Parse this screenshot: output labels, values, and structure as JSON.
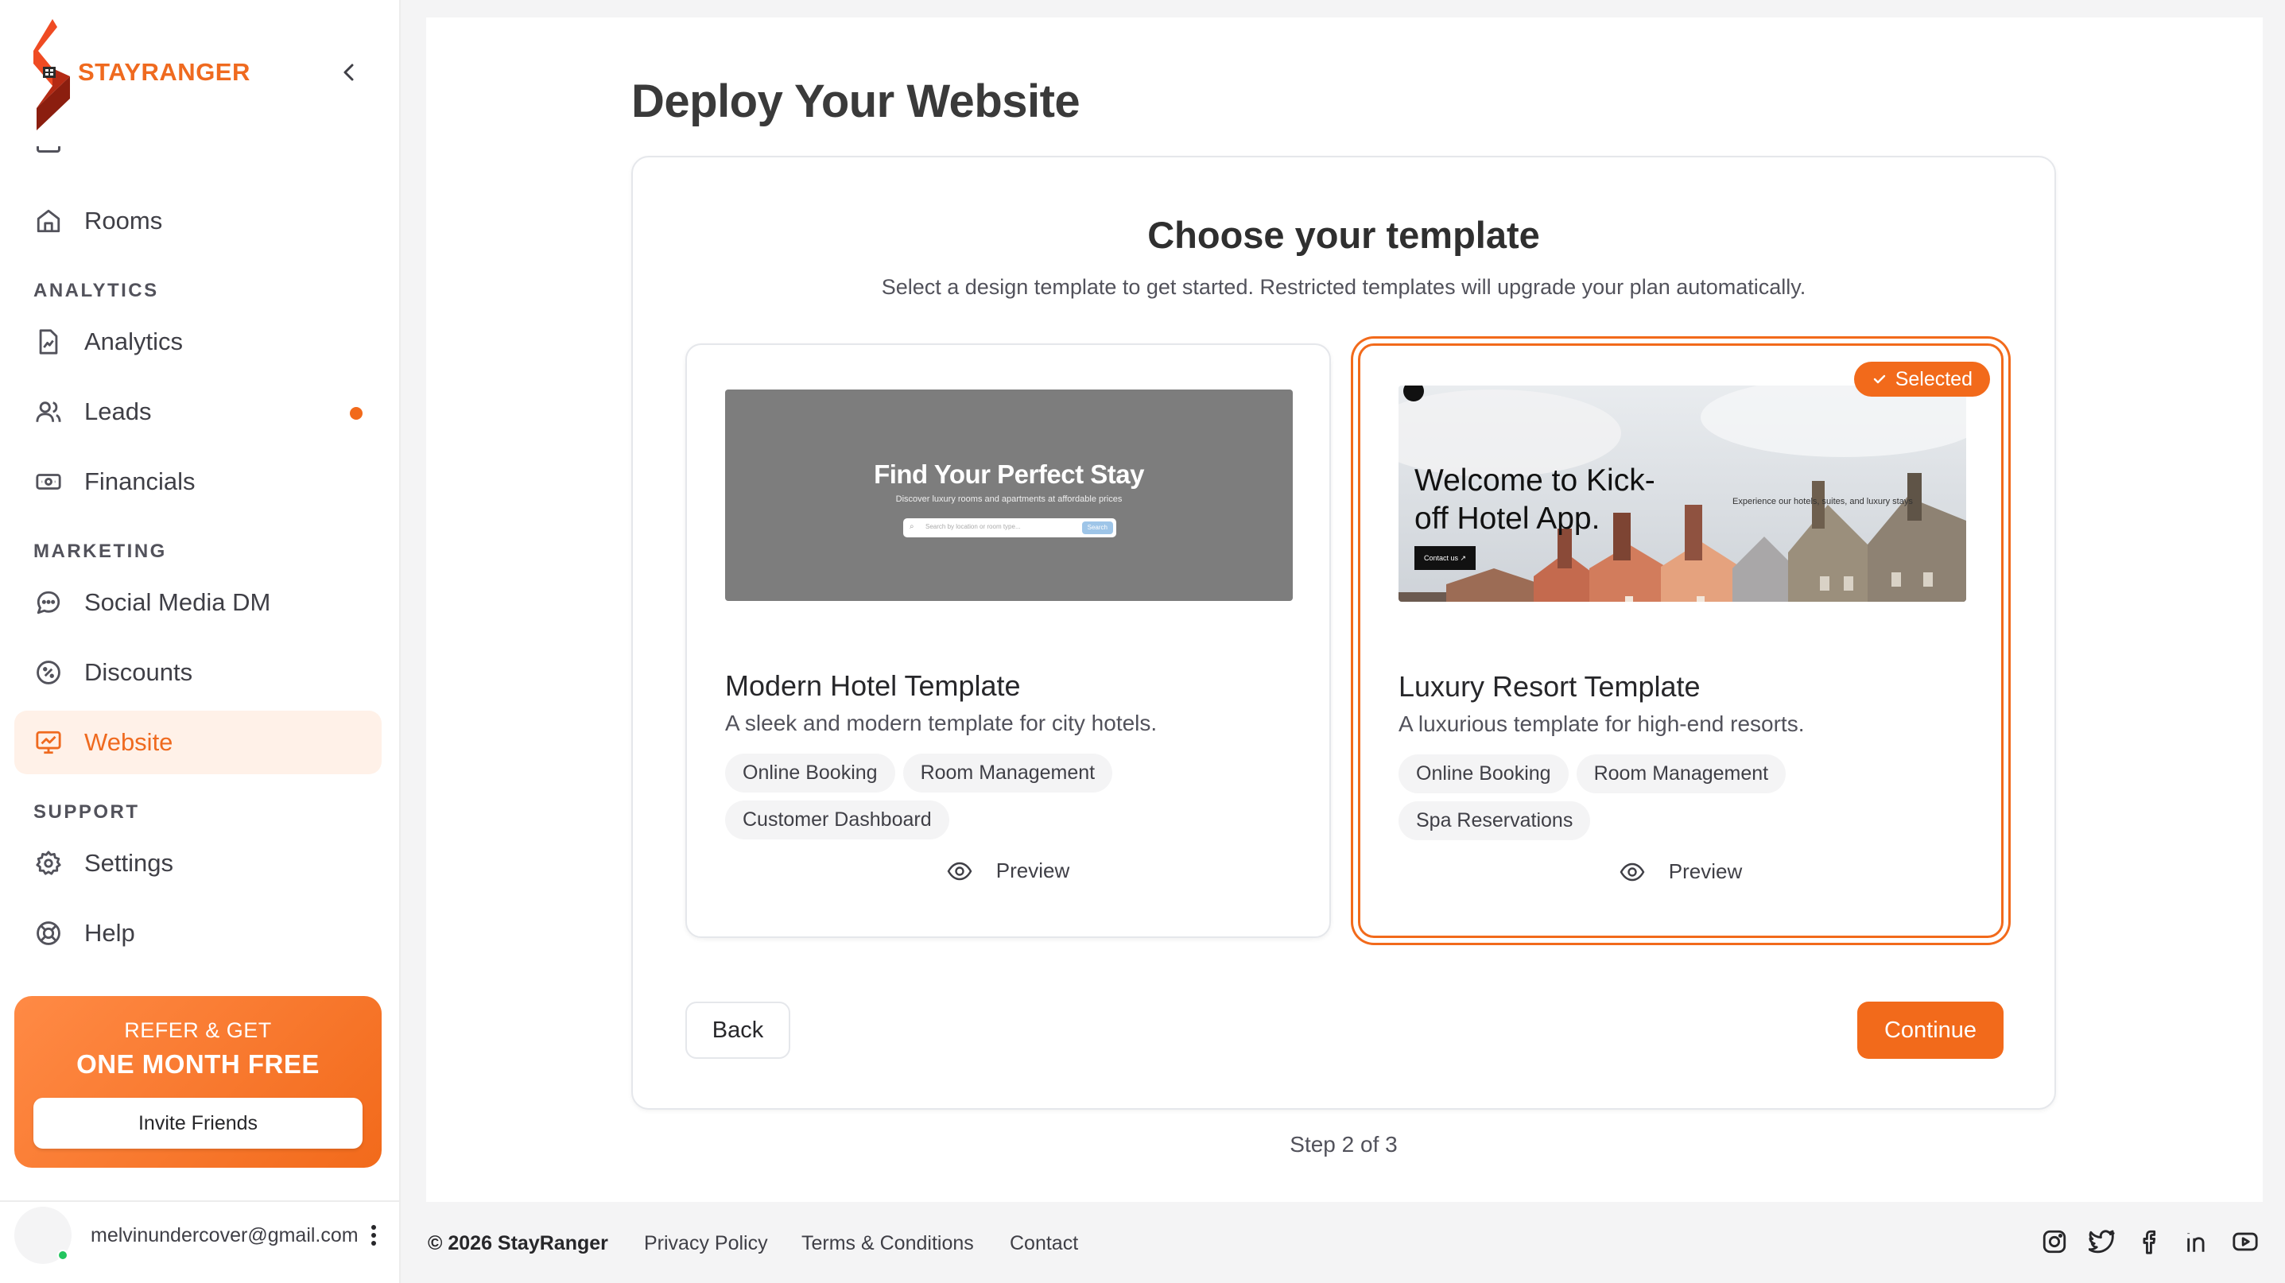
{
  "brand": {
    "name": "STAYRANGER",
    "accent": "#f26a1b"
  },
  "sidebar": {
    "items": [
      {
        "label": "Rooms",
        "icon": "home-icon"
      },
      {
        "label": "Analytics",
        "icon": "file-chart-icon"
      },
      {
        "label": "Leads",
        "icon": "users-icon",
        "has_dot": true
      },
      {
        "label": "Financials",
        "icon": "banknote-icon"
      },
      {
        "label": "Social Media DM",
        "icon": "message-circle-icon"
      },
      {
        "label": "Discounts",
        "icon": "badge-percent-icon"
      },
      {
        "label": "Website",
        "icon": "monitor-icon",
        "active": true
      },
      {
        "label": "Settings",
        "icon": "gear-icon"
      },
      {
        "label": "Help",
        "icon": "life-buoy-icon"
      }
    ],
    "sections": {
      "analytics": "ANALYTICS",
      "marketing": "MARKETING",
      "support": "SUPPORT"
    },
    "promo": {
      "line1": "REFER & GET",
      "line2": "ONE MONTH FREE",
      "button": "Invite Friends"
    },
    "user": {
      "email": "melvinundercover@gmail.com"
    }
  },
  "main": {
    "title": "Deploy Your Website",
    "choose_title": "Choose your template",
    "choose_subtitle": "Select a design template to get started. Restricted templates will upgrade your plan automatically.",
    "templates": [
      {
        "name": "Modern Hotel Template",
        "description": "A sleek and modern template for city hotels.",
        "features": [
          "Online Booking",
          "Room Management",
          "Customer Dashboard"
        ],
        "preview_label": "Preview",
        "thumb": {
          "headline": "Find Your Perfect Stay",
          "sub": "Discover luxury rooms and apartments at affordable prices",
          "search_placeholder": "Search by location or room type...",
          "search_button": "Search"
        }
      },
      {
        "name": "Luxury Resort Template",
        "description": "A luxurious template for high-end resorts.",
        "features": [
          "Online Booking",
          "Room Management",
          "Spa Reservations"
        ],
        "preview_label": "Preview",
        "selected": true,
        "badge": "Selected",
        "thumb": {
          "headline": "Welcome to Kick-off Hotel App.",
          "side_text": "Experience our hotels, suites, and luxury stays",
          "cta": "Contact us"
        }
      }
    ],
    "back_label": "Back",
    "continue_label": "Continue",
    "step_text": "Step 2 of 3"
  },
  "footer": {
    "copyright": "© 2026 StayRanger",
    "links": [
      "Privacy Policy",
      "Terms & Conditions",
      "Contact"
    ],
    "social": [
      "instagram-icon",
      "twitter-icon",
      "facebook-icon",
      "linkedin-icon",
      "youtube-icon"
    ]
  }
}
